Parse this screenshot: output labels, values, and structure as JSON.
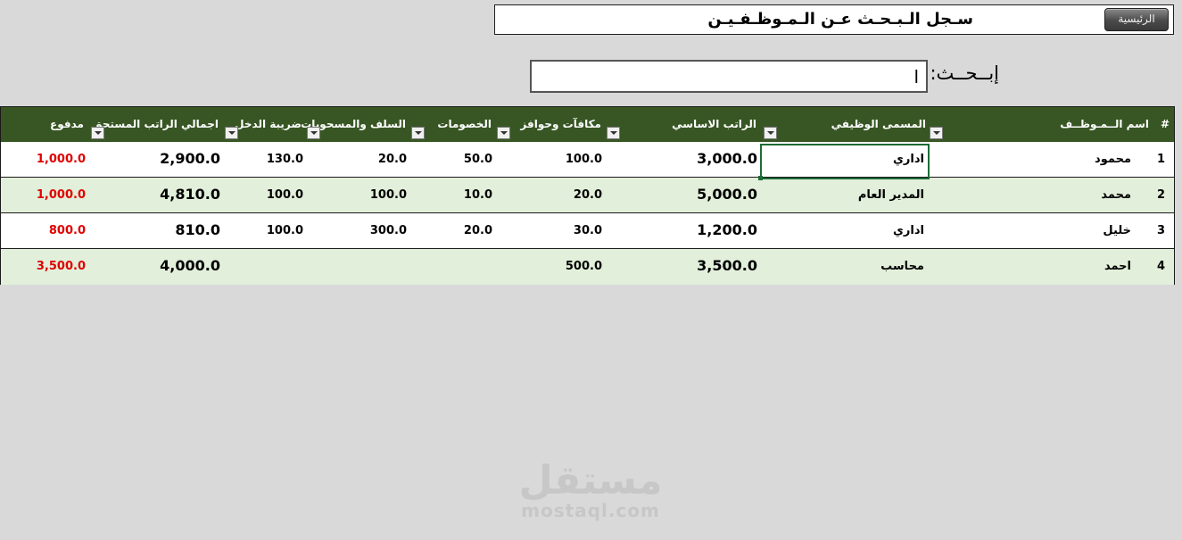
{
  "header": {
    "title": "سـجل الـبـحـث عـن الـمـوظـفـيـن",
    "home_button": "الرئيسية"
  },
  "search": {
    "label": "إبــحــث:",
    "value": "ا"
  },
  "table": {
    "columns": {
      "num": "#",
      "name": "اسم الــمـوظــف",
      "title": "المسمى الوظيفي",
      "salary": "الراتب الاساسي",
      "bonus": "مكافآت وحوافز",
      "deductions": "الخصومات",
      "advances": "السلف والمسحوبات",
      "tax": "ضريبة الدخل",
      "total": "اجمالي الراتب المستحق",
      "paid": "مدفوع"
    },
    "rows": [
      {
        "num": "1",
        "name": "محمود",
        "title": "اداري",
        "salary": "3,000.0",
        "bonus": "100.0",
        "deductions": "50.0",
        "advances": "20.0",
        "tax": "130.0",
        "total": "2,900.0",
        "paid": "1,000.0"
      },
      {
        "num": "2",
        "name": "محمد",
        "title": "المدير العام",
        "salary": "5,000.0",
        "bonus": "20.0",
        "deductions": "10.0",
        "advances": "100.0",
        "tax": "100.0",
        "total": "4,810.0",
        "paid": "1,000.0"
      },
      {
        "num": "3",
        "name": "خليل",
        "title": "اداري",
        "salary": "1,200.0",
        "bonus": "30.0",
        "deductions": "20.0",
        "advances": "300.0",
        "tax": "100.0",
        "total": "810.0",
        "paid": "800.0"
      },
      {
        "num": "4",
        "name": "احمد",
        "title": "محاسب",
        "salary": "3,500.0",
        "bonus": "500.0",
        "deductions": "",
        "advances": "",
        "tax": "",
        "total": "4,000.0",
        "paid": "3,500.0"
      }
    ]
  },
  "watermark": {
    "arabic": "مستقل",
    "latin": "mostaql.com"
  },
  "colors": {
    "header_bg": "#375623",
    "row_alt": "#e2efda",
    "paid_red": "#e00000",
    "selection": "#1e6b36"
  }
}
